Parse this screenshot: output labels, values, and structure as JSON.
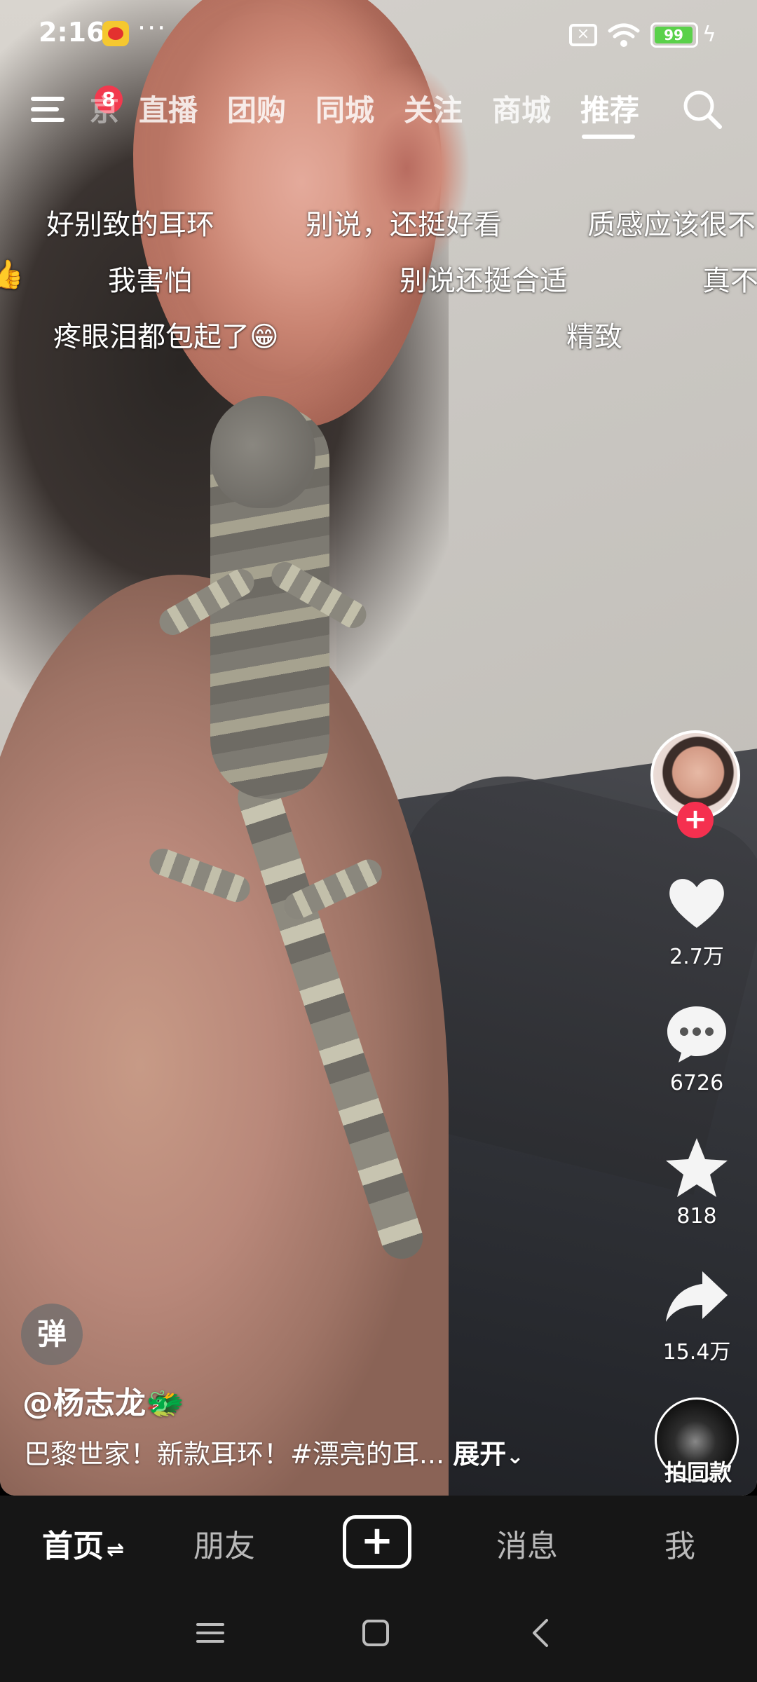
{
  "status_bar": {
    "time": "2:16",
    "overflow": "···",
    "battery": "99",
    "icons": [
      "weibo-notification-icon",
      "sim-blocked-icon",
      "wifi-icon",
      "battery-icon",
      "charging-icon"
    ]
  },
  "top_nav": {
    "menu_badge": "8",
    "partial_tab": "京",
    "tabs": [
      "直播",
      "团购",
      "同城",
      "关注",
      "商城",
      "推荐"
    ],
    "active_tab": "推荐"
  },
  "danmaku": [
    "好别致的耳环",
    "别说，还挺好看",
    "质感应该很不",
    "👍",
    "我害怕",
    "别说还挺合适",
    "真不",
    "疼眼泪都包起了😁",
    "精致"
  ],
  "right_rail": {
    "likes": "2.7万",
    "comments": "6726",
    "favorites": "818",
    "shares": "15.4万",
    "same_style_label": "拍同款"
  },
  "video_info": {
    "danmu_toggle": "弹",
    "author": "@杨志龙🐲",
    "caption": "巴黎世家！新款耳环！#漂亮的耳...",
    "expand_label": "展开"
  },
  "bottom_tabs": {
    "home": "首页",
    "friends": "朋友",
    "messages": "消息",
    "me": "我",
    "home_swap_icon": "⇌"
  },
  "colors": {
    "accent_red": "#f5304f",
    "battery_green": "#5ad14a",
    "tabbar_bg": "#161616"
  }
}
